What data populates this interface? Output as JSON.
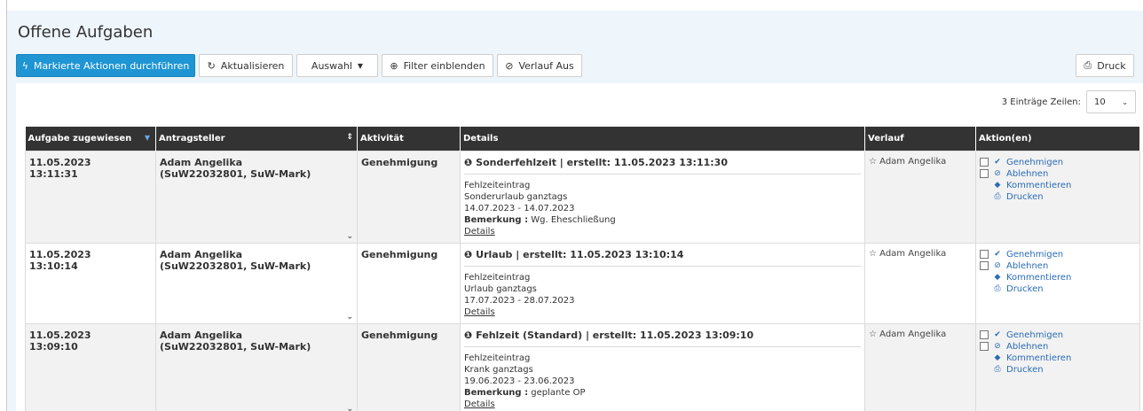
{
  "page": {
    "title": "Offene Aufgaben"
  },
  "toolbar": {
    "execute": "Markierte Aktionen durchführen",
    "refresh": "Aktualisieren",
    "selection": "Auswahl",
    "filter": "Filter einblenden",
    "history": "Verlauf Aus",
    "print": "Druck"
  },
  "table_meta": {
    "entries_text": "3 Einträge Zeilen:",
    "page_size": "10"
  },
  "columns": [
    "Aufgabe zugewiesen",
    "Antragsteller",
    "Aktivität",
    "Details",
    "Verlauf",
    "Aktion(en)"
  ],
  "rows": [
    {
      "date": "11.05.2023",
      "time": "13:11:31",
      "applicant_name": "Adam Angelika",
      "applicant_id": "(SuW22032801, SuW-Mark)",
      "activity": "Genehmigung",
      "details": {
        "header": "Sonderfehlzeit  |  erstellt: 11.05.2023  13:11:30",
        "type": "Fehlzeiteintrag",
        "kind": "Sonderurlaub  ganztags",
        "range": "14.07.2023 - 14.07.2023",
        "remark_label": "Bemerkung :",
        "remark": " Wg. Eheschließung",
        "link": "Details"
      },
      "history": "Adam Angelika"
    },
    {
      "date": "11.05.2023",
      "time": "13:10:14",
      "applicant_name": "Adam Angelika",
      "applicant_id": "(SuW22032801, SuW-Mark)",
      "activity": "Genehmigung",
      "details": {
        "header": "Urlaub  |  erstellt: 11.05.2023  13:10:14",
        "type": "Fehlzeiteintrag",
        "kind": "Urlaub  ganztags",
        "range": "17.07.2023 - 28.07.2023",
        "link": "Details"
      },
      "history": "Adam Angelika"
    },
    {
      "date": "11.05.2023",
      "time": "13:09:10",
      "applicant_name": "Adam Angelika",
      "applicant_id": "(SuW22032801, SuW-Mark)",
      "activity": "Genehmigung",
      "details": {
        "header": "Fehlzeit (Standard)  |  erstellt: 11.05.2023  13:09:10",
        "type": "Fehlzeiteintrag",
        "kind": "Krank  ganztags",
        "range": "19.06.2023 - 23.06.2023",
        "remark_label": "Bemerkung :",
        "remark": " geplante OP",
        "link": "Details"
      },
      "history": "Adam Angelika"
    }
  ],
  "actions": {
    "approve": "Genehmigen",
    "reject": "Ablehnen",
    "comment": "Kommentieren",
    "print": "Drucken"
  },
  "colors": {
    "primary": "#1f95d3",
    "header_bg": "#333333",
    "link": "#2b6cb8",
    "panel": "#eef5fb"
  },
  "icons": [
    "bolt-icon",
    "refresh-icon",
    "caret-down-icon",
    "search-plus-icon",
    "ban-icon",
    "print-icon",
    "info-icon",
    "star-icon",
    "check-icon",
    "tag-icon",
    "chevron-down-icon",
    "sort-icon"
  ]
}
